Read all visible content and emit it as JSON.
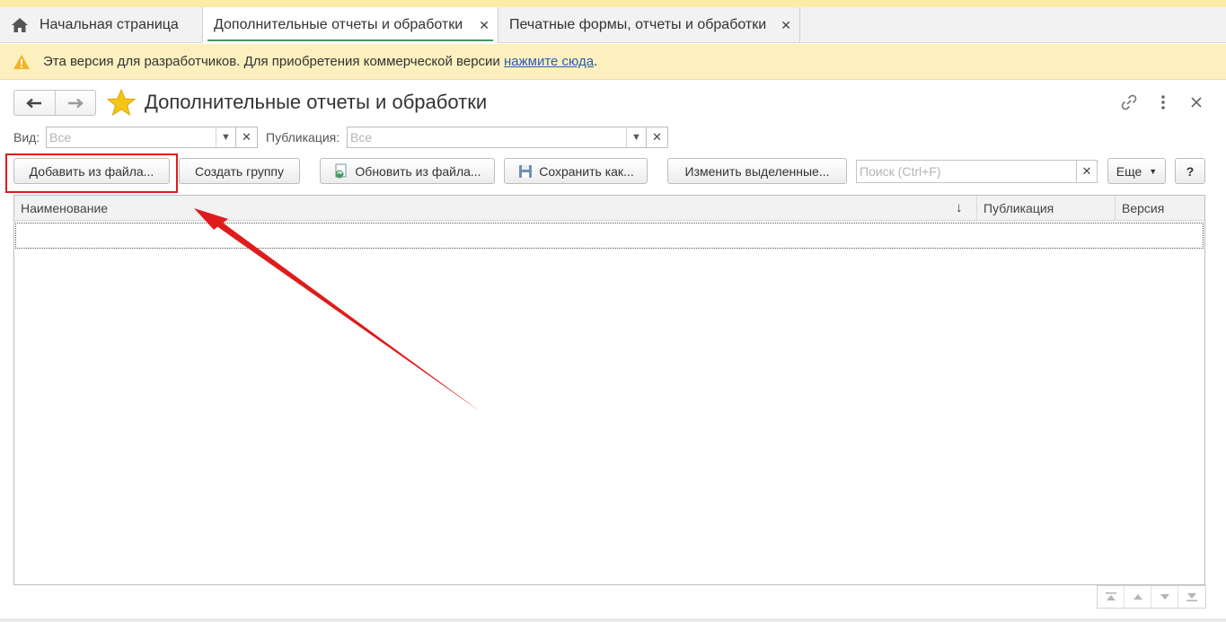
{
  "tabs": {
    "home": "Начальная страница",
    "active": "Дополнительные отчеты и обработки",
    "third": "Печатные формы, отчеты и обработки"
  },
  "warning": {
    "text": "Эта версия для разработчиков. Для приобретения коммерческой версии ",
    "link": "нажмите сюда",
    "suffix": "."
  },
  "header": {
    "title": "Дополнительные отчеты и обработки"
  },
  "filters": {
    "kind_label": "Вид:",
    "kind_value": "Все",
    "publication_label": "Публикация:",
    "publication_value": "Все"
  },
  "toolbar": {
    "add_from_file": "Добавить из файла...",
    "create_group": "Создать группу",
    "update_from_file": "Обновить из файла...",
    "save_as": "Сохранить как...",
    "change_selected": "Изменить выделенные...",
    "search_placeholder": "Поиск (Ctrl+F)",
    "more": "Еще",
    "help": "?"
  },
  "table": {
    "columns": [
      "Наименование",
      "Публикация",
      "Версия"
    ],
    "rows": []
  },
  "colors": {
    "annotation": "#e01b1b",
    "active_tab_underline": "#3f9a5c",
    "warning_bg": "#fcf0bf",
    "link": "#2a5db0"
  }
}
